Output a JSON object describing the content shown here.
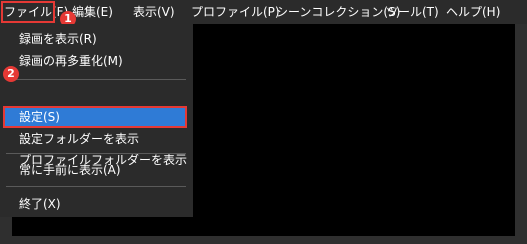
{
  "menubar": {
    "items": [
      "ファイル(F)",
      "編集(E)",
      "表示(V)",
      "プロファイル(P)",
      "シーンコレクション(S)",
      "ツール(T)",
      "ヘルプ(H)"
    ]
  },
  "file_menu": {
    "items": [
      "録画を表示(R)",
      "録画の再多重化(M)",
      "設定(S)",
      "設定フォルダーを表示",
      "プロファイルフォルダーを表示",
      "常に手前に表示(A)",
      "終了(X)"
    ]
  },
  "annotations": {
    "badge_1": "1",
    "badge_2": "2"
  },
  "colors": {
    "highlight_red": "#e53935",
    "selection_blue": "#2f7bd6",
    "menu_bg": "#2b2b2b"
  }
}
